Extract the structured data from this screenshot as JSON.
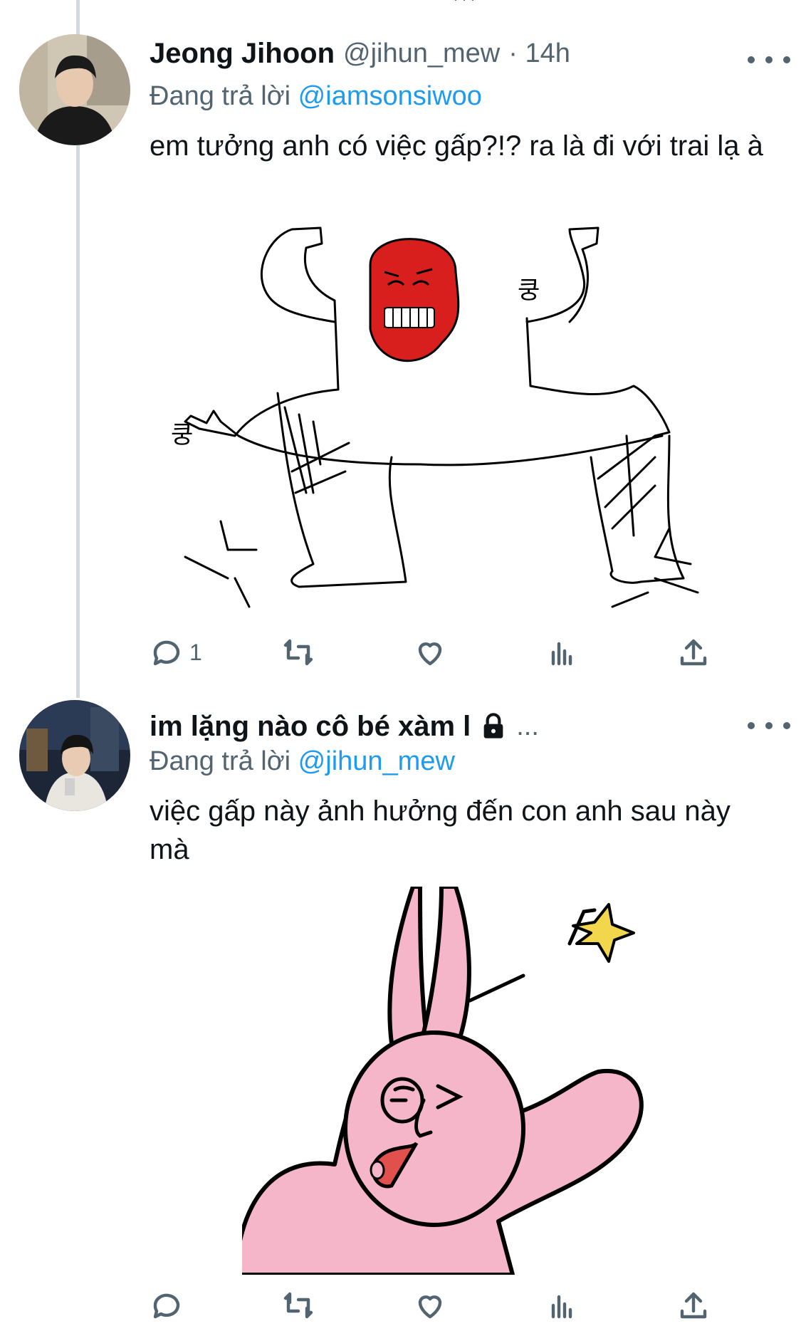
{
  "tweets": [
    {
      "name": "Jeong Jihoon",
      "handle": "@jihun_mew",
      "time": "· 14h",
      "reply_prefix": "Đang trả lời",
      "reply_to": "@iamsonsiwoo",
      "text": "em tưởng anh có việc gấp?!? ra là đi với trai lạ à",
      "media_text": [
        "쿵",
        "쿵"
      ],
      "actions": {
        "reply_count": "1"
      }
    },
    {
      "name": "im lặng nào cô bé xàm l",
      "name_suffix": "...",
      "reply_prefix": "Đang trả lời",
      "reply_to": "@jihun_mew",
      "text": "việc gấp này ảnh hưởng đến con anh sau này mà"
    }
  ],
  "icons": [
    "reply-icon",
    "retweet-icon",
    "like-icon",
    "analytics-icon",
    "share-icon",
    "more-icon",
    "lock-icon"
  ],
  "colors": {
    "accent": "#1d9bf0",
    "secondary_text": "#536471",
    "thread_line": "#cfd9de"
  }
}
